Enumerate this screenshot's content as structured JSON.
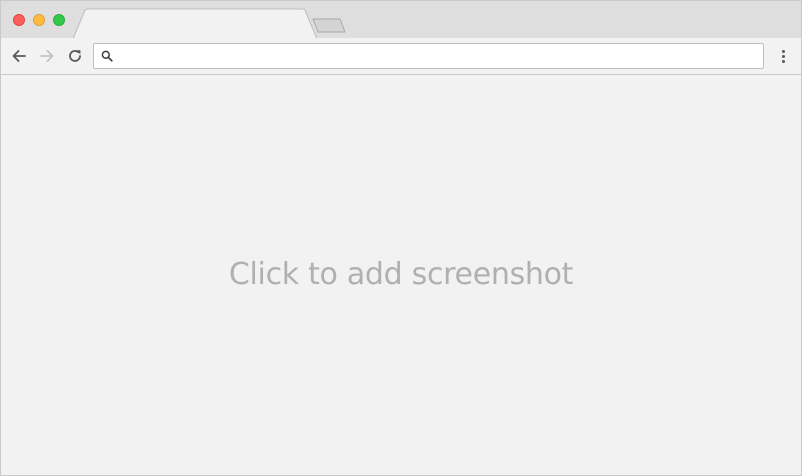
{
  "browser": {
    "tab": {
      "title": ""
    },
    "omnibox": {
      "value": "",
      "placeholder": ""
    },
    "icons": {
      "back": "arrow-left-icon",
      "forward": "arrow-right-icon",
      "reload": "reload-icon",
      "search": "search-icon",
      "menu": "kebab-menu-icon"
    },
    "forward_enabled": false
  },
  "content": {
    "placeholder": "Click to add screenshot"
  },
  "colors": {
    "close": "#fc605c",
    "minimize": "#fdbc40",
    "maximize": "#34c84a",
    "chrome": "#dedede",
    "background": "#f2f2f2",
    "placeholder_text": "#b0b0b0"
  }
}
